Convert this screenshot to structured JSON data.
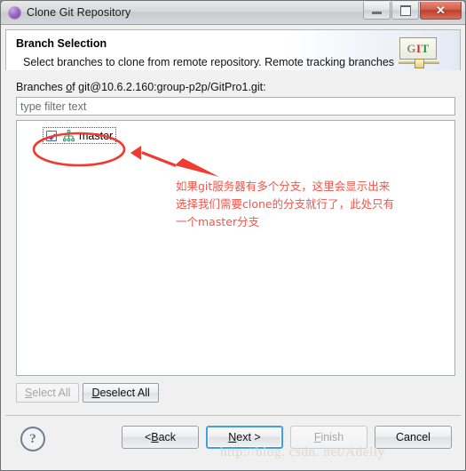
{
  "window": {
    "title": "Clone Git Repository",
    "icon": "purple-sphere-icon",
    "controls": {
      "minimize": "—",
      "maximize": "□",
      "close": "✕"
    }
  },
  "header": {
    "title": "Branch Selection",
    "description": "Select branches to clone from remote repository. Remote tracking branches will be created to track updates for these branches in the",
    "logo": {
      "g": "G",
      "i": "I",
      "t": "T"
    }
  },
  "main": {
    "branches_label_prefix": "Branches ",
    "branches_label_accel": "o",
    "branches_label_suffix": "f git@10.6.2.160:group-p2p/GitPro1.git:",
    "filter": {
      "value": "",
      "placeholder": "type filter text"
    },
    "branches": [
      {
        "name": "master",
        "checked": true,
        "icon": "git-branch-icon"
      }
    ],
    "select_all": {
      "label_accel": "S",
      "label_rest": "elect All",
      "enabled": false
    },
    "deselect_all": {
      "label_accel": "D",
      "label_rest": "eselect All",
      "enabled": true
    }
  },
  "annotation": {
    "text": "如果git服务器有多个分支，这里会显示出来\n选择我们需要clone的分支就行了，此处只有\n一个master分支",
    "color": "#f4554a",
    "ellipse": "red-ellipse-highlight",
    "arrow": "red-arrow-pointer"
  },
  "footer": {
    "help": "?",
    "back": {
      "prefix": "< ",
      "accel": "B",
      "rest": "ack"
    },
    "next": {
      "prefix": "",
      "accel": "N",
      "rest": "ext >",
      "focused": true
    },
    "finish": {
      "prefix": "",
      "accel": "F",
      "rest": "inish",
      "enabled": false
    },
    "cancel": {
      "label": "Cancel"
    }
  },
  "watermark": "http://blog. csdn. net/Adeliy"
}
